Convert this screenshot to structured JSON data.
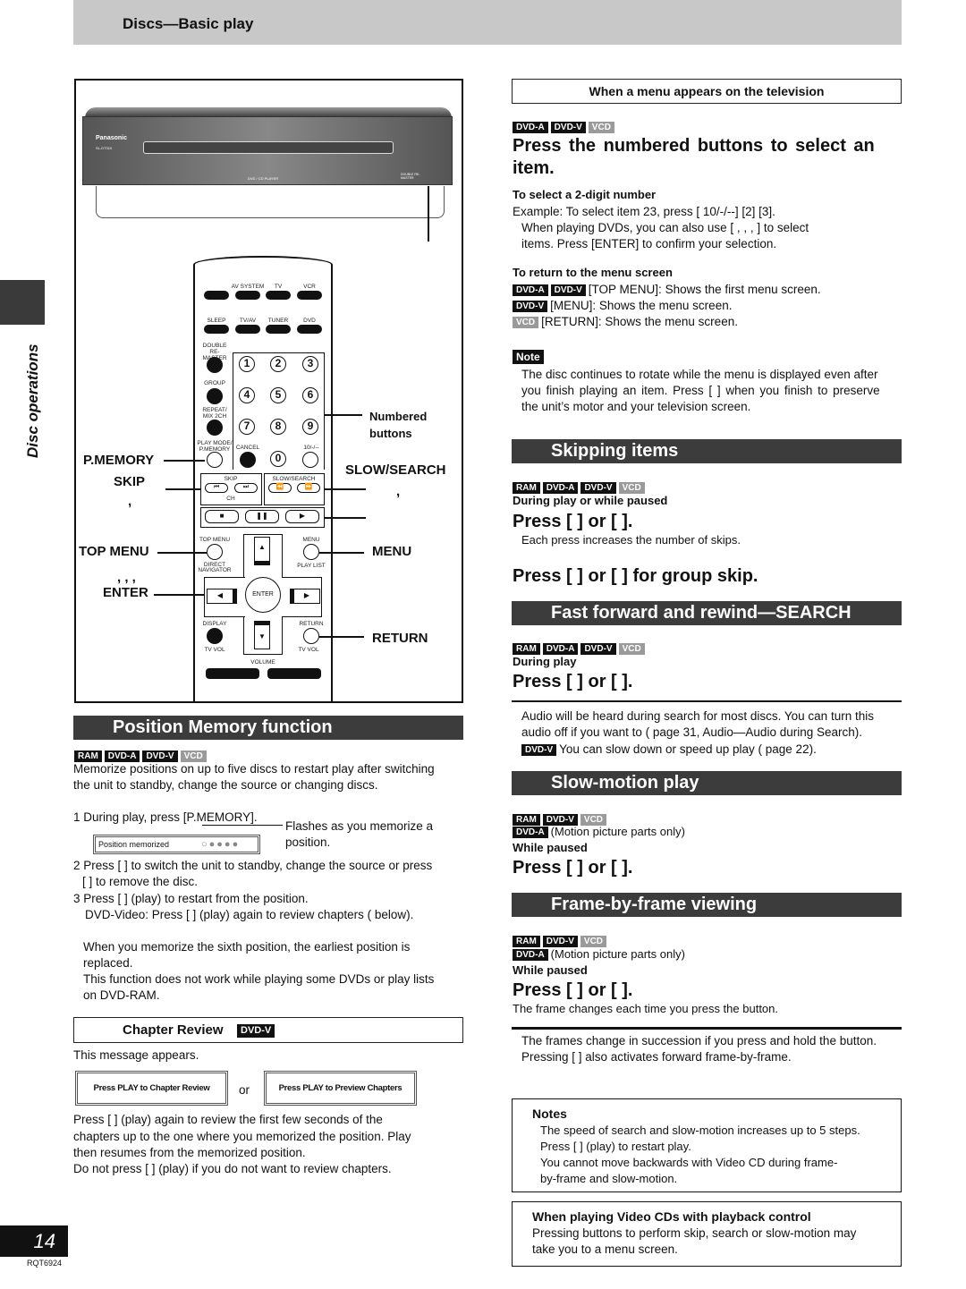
{
  "header": {
    "title": "Discs—Basic play"
  },
  "side_tab": {
    "label": "Disc operations"
  },
  "footer": {
    "page_number": "14",
    "code": "RQT6924"
  },
  "badges": {
    "ram": "RAM",
    "dvda": "DVD-A",
    "dvdv": "DVD-V",
    "vcd": "VCD"
  },
  "device": {
    "brand": "Panasonic",
    "model": "SL-DT310",
    "label": "DVD / CD PLAYER",
    "double_remaster": "DOUBLE RE-MASTER"
  },
  "remote": {
    "row1": [
      "",
      "AV SYSTEM",
      "TV",
      "VCR"
    ],
    "row2": [
      "SLEEP",
      "TV/AV",
      "TUNER",
      "DVD"
    ],
    "double_remaster": "DOUBLE RE-MASTER",
    "group": "GROUP",
    "repeat": "REPEAT/ MIX 2CH",
    "play_mode": "PLAY MODE/ P.MEMORY",
    "cancel": "CANCEL",
    "ten": "10/-/--",
    "numbers": [
      "1",
      "2",
      "3",
      "4",
      "5",
      "6",
      "7",
      "8",
      "9",
      "0"
    ],
    "skip": "SKIP",
    "ch": "CH",
    "slow_search": "SLOW/SEARCH",
    "top_menu": "TOP MENU",
    "direct_navigator": "DIRECT NAVIGATOR",
    "menu": "MENU",
    "play_list": "PLAY LIST",
    "enter": "ENTER",
    "display": "DISPLAY",
    "tv_vol": "TV VOL",
    "return": "RETURN",
    "volume": "VOLUME",
    "callouts": {
      "numbered": "Numbered",
      "buttons": "buttons",
      "pmemory": "P.MEMORY",
      "skip": "SKIP",
      "comma": ",",
      "slow_search": "SLOW/SEARCH",
      "top_menu": "TOP MENU",
      "arrows": ",   ,   ,",
      "enter": "ENTER",
      "menu": "MENU",
      "return": "RETURN"
    }
  },
  "position_memory": {
    "title": "Position Memory function",
    "intro": [
      "Memorize positions on up to five discs to restart play after switching",
      "the unit to standby, change the source or changing discs."
    ],
    "step1": "1 During play, press [P.MEMORY].",
    "display_text": "Position memorized",
    "flash_note": [
      "Flashes as you memorize a",
      "position."
    ],
    "step2": [
      "2 Press [    ] to switch the unit to standby, change the source or press",
      "[    ] to remove the disc."
    ],
    "step3": [
      "3 Press [    ] (play) to restart from the position.",
      "DVD-Video: Press [    ] (play) again to review chapters (     below)."
    ],
    "notes": [
      "When you memorize the sixth position, the earliest position is",
      "replaced.",
      "This function does not work while playing some DVDs or play lists",
      "on DVD-RAM."
    ]
  },
  "chapter_review": {
    "title": "Chapter Review",
    "appears": "This message appears.",
    "msg1": "Press PLAY to Chapter Review",
    "or": "or",
    "msg2": "Press PLAY to Preview Chapters",
    "text": [
      "Press [    ] (play) again to review the first few seconds of the",
      "chapters up to the one where you memorized the position. Play",
      "then resumes from the memorized position.",
      "Do not press [    ] (play) if you do not want to review chapters."
    ]
  },
  "menu_section": {
    "box_title": "When a menu appears on the television",
    "heading": [
      "Press the numbered buttons to select an",
      "item."
    ],
    "two_digit_title": "To select a 2-digit number",
    "two_digit": [
      "Example:  To select item 23, press [    10/-/--]     [2]     [3].",
      "When playing DVDs, you can also use [     ,       ,       ,      ] to select",
      "items. Press [ENTER] to confirm your selection."
    ],
    "return_title": "To return to the menu screen",
    "return_lines": [
      "[TOP MENU]:  Shows the first menu screen.",
      "[MENU]:  Shows the menu screen.",
      "[RETURN]:  Shows the menu screen."
    ],
    "note_label": "Note",
    "note": [
      "The disc continues to rotate while the menu is displayed even after",
      "you finish playing an item. Press [    ] when you finish to preserve",
      "the unit’s motor and your television screen."
    ]
  },
  "skipping": {
    "title": "Skipping items",
    "when": "During play or while paused",
    "press": "Press [        ] or [        ].",
    "sub": "Each press increases the number of skips.",
    "group": "Press [    ] or [    ] for group skip."
  },
  "search": {
    "title": "Fast forward and rewind—SEARCH",
    "when": "During play",
    "press": "Press [        ] or [        ].",
    "notes": [
      "Audio will be heard during search for most discs. You can turn this",
      "audio off if you want to (     page 31, Audio—Audio during Search).",
      "You can slow down or speed up play (     page 22)."
    ]
  },
  "slow": {
    "title": "Slow-motion play",
    "motion": "(Motion picture parts only)",
    "when": "While paused",
    "press": "Press [        ] or [        ]."
  },
  "frame": {
    "title": "Frame-by-frame viewing",
    "motion": "(Motion picture parts only)",
    "when": "While paused",
    "press": "Press [    ] or [    ].",
    "sub": "The frame changes each time you press the button.",
    "notes": [
      "The frames change in succession if you press and hold the button.",
      "Pressing [    ] also activates forward frame-by-frame."
    ]
  },
  "notes_box": {
    "title": "Notes",
    "lines": [
      "The speed of search and slow-motion increases up to 5 steps.",
      "Press [    ] (play) to restart play.",
      "You cannot move backwards with Video CD during frame-",
      "by-frame and slow-motion."
    ]
  },
  "vcd_box": {
    "title": "When playing Video CDs with playback control",
    "lines": [
      "Pressing buttons to perform skip, search or slow-motion may",
      "take you to a menu screen."
    ]
  }
}
